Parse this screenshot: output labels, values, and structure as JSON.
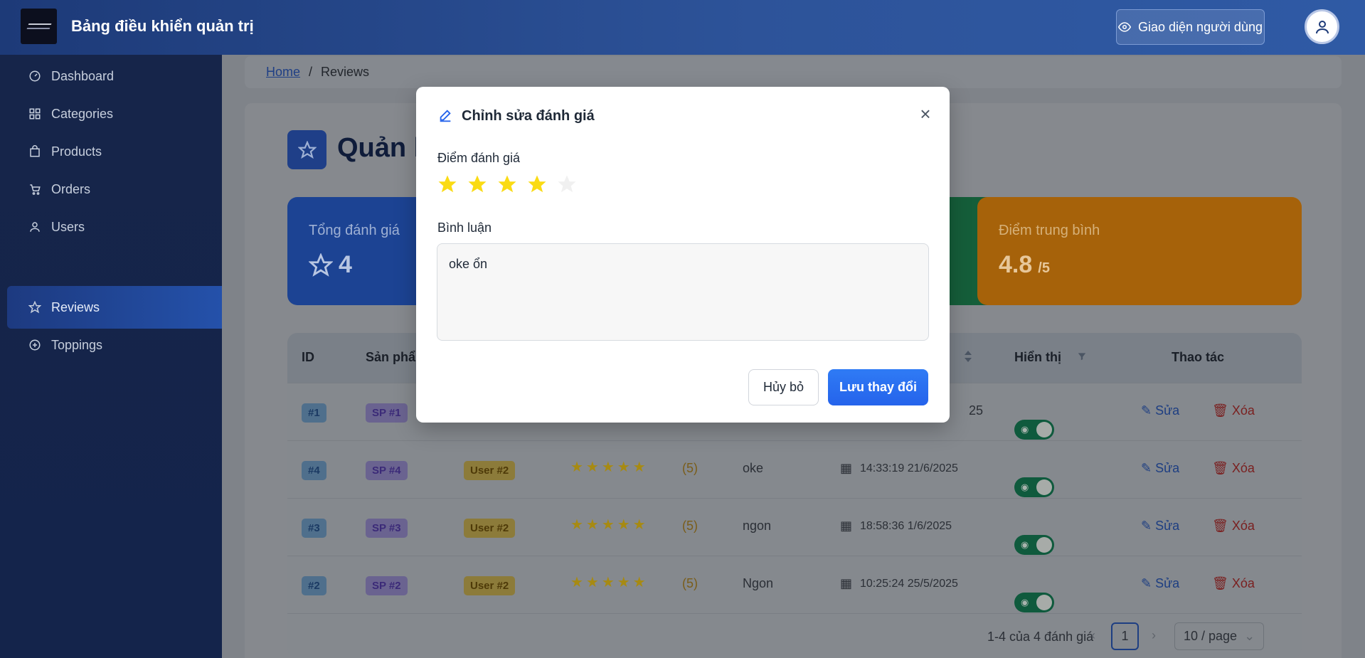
{
  "header": {
    "title": "Bảng điều khiển quản trị",
    "user_view_label": "Giao diện người dùng"
  },
  "sidebar": {
    "items": [
      {
        "label": "Dashboard",
        "icon": "dashboard-icon"
      },
      {
        "label": "Categories",
        "icon": "grid-icon"
      },
      {
        "label": "Products",
        "icon": "bag-icon"
      },
      {
        "label": "Orders",
        "icon": "cart-icon"
      },
      {
        "label": "Users",
        "icon": "user-icon"
      },
      {
        "label": "Reviews",
        "icon": "star-icon",
        "active": true
      },
      {
        "label": "Toppings",
        "icon": "plus-circle-icon"
      }
    ]
  },
  "breadcrumb": {
    "home": "Home",
    "separator": "/",
    "current": "Reviews"
  },
  "page": {
    "title": "Quản l"
  },
  "stats": {
    "total_label": "Tổng đánh giá",
    "total_value": "4",
    "avg_label": "Điểm trung bình",
    "avg_value": "4.8",
    "avg_suffix": "/5"
  },
  "table": {
    "headers": {
      "id": "ID",
      "product": "Sản phẩm",
      "visible": "Hiển thị",
      "actions": "Thao tác"
    },
    "rows": [
      {
        "id": "#1",
        "product": "SP #1",
        "time_partial": "25",
        "edit": "Sửa",
        "delete": "Xóa"
      },
      {
        "id": "#4",
        "product": "SP #4",
        "user": "User #2",
        "rating": 5,
        "rating_text": "(5)",
        "comment": "oke",
        "time": "14:33:19 21/6/2025",
        "edit": "Sửa",
        "delete": "Xóa"
      },
      {
        "id": "#3",
        "product": "SP #3",
        "user": "User #2",
        "rating": 5,
        "rating_text": "(5)",
        "comment": "ngon",
        "time": "18:58:36 1/6/2025",
        "edit": "Sửa",
        "delete": "Xóa"
      },
      {
        "id": "#2",
        "product": "SP #2",
        "user": "User #2",
        "rating": 5,
        "rating_text": "(5)",
        "comment": "Ngon",
        "time": "10:25:24 25/5/2025",
        "edit": "Sửa",
        "delete": "Xóa"
      }
    ],
    "pagination": {
      "summary": "1-4 của 4 đánh giá",
      "current_page": "1",
      "page_size": "10 / page"
    }
  },
  "modal": {
    "title": "Chỉnh sửa đánh giá",
    "rating_label": "Điểm đánh giá",
    "rating_value": 4,
    "rating_max": 5,
    "comment_label": "Bình luận",
    "comment_value": "oke ổn",
    "cancel_label": "Hủy bỏ",
    "save_label": "Lưu thay đổi"
  },
  "colors": {
    "accent": "#2563eb",
    "star_filled": "#fadb14",
    "star_empty": "#f0f0f0",
    "header_bg": "#2d5399"
  }
}
